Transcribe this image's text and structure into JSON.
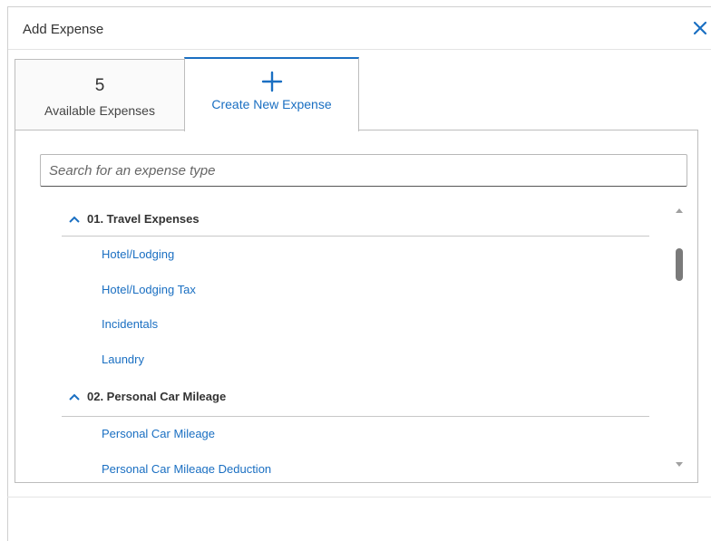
{
  "dialog": {
    "title": "Add Expense",
    "close_icon": "close-icon"
  },
  "tabs": {
    "available": {
      "count": "5",
      "label": "Available Expenses"
    },
    "create": {
      "icon": "plus-icon",
      "label": "Create New Expense"
    }
  },
  "search": {
    "placeholder": "Search for an expense type",
    "value": ""
  },
  "groups": [
    {
      "label": "01. Travel Expenses",
      "expanded": true,
      "items": [
        "Hotel/Lodging",
        "Hotel/Lodging Tax",
        "Incidentals",
        "Laundry"
      ]
    },
    {
      "label": "02. Personal Car Mileage",
      "expanded": true,
      "items": [
        "Personal Car Mileage",
        "Personal Car Mileage Deduction"
      ]
    }
  ],
  "colors": {
    "accent": "#1a6fc2",
    "border": "#bdbdbd",
    "text": "#333333"
  }
}
